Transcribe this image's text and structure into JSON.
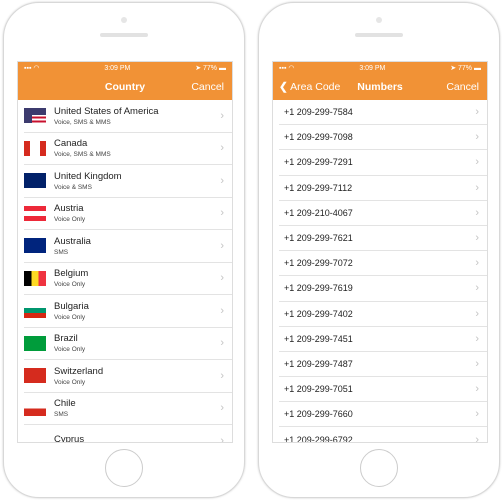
{
  "status": {
    "time": "3:09 PM",
    "battery": "77%"
  },
  "left": {
    "title": "Country",
    "cancel": "Cancel",
    "countries": [
      {
        "name": "United States of America",
        "services": "Voice, SMS & MMS",
        "flag": "us"
      },
      {
        "name": "Canada",
        "services": "Voice, SMS & MMS",
        "flag": "ca"
      },
      {
        "name": "United Kingdom",
        "services": "Voice & SMS",
        "flag": "gb"
      },
      {
        "name": "Austria",
        "services": "Voice Only",
        "flag": "at"
      },
      {
        "name": "Australia",
        "services": "SMS",
        "flag": "au"
      },
      {
        "name": "Belgium",
        "services": "Voice Only",
        "flag": "be"
      },
      {
        "name": "Bulgaria",
        "services": "Voice Only",
        "flag": "bg"
      },
      {
        "name": "Brazil",
        "services": "Voice Only",
        "flag": "br"
      },
      {
        "name": "Switzerland",
        "services": "Voice Only",
        "flag": "ch"
      },
      {
        "name": "Chile",
        "services": "SMS",
        "flag": "cl"
      },
      {
        "name": "Cyprus",
        "services": "",
        "flag": "cy"
      }
    ]
  },
  "right": {
    "back": "Area Code",
    "title": "Numbers",
    "cancel": "Cancel",
    "numbers": [
      "+1 209-299-7584",
      "+1 209-299-7098",
      "+1 209-299-7291",
      "+1 209-299-7112",
      "+1 209-210-4067",
      "+1 209-299-7621",
      "+1 209-299-7072",
      "+1 209-299-7619",
      "+1 209-299-7402",
      "+1 209-299-7451",
      "+1 209-299-7487",
      "+1 209-299-7051",
      "+1 209-299-7660",
      "+1 209-299-6792"
    ]
  },
  "colors": {
    "accent": "#f19236"
  }
}
